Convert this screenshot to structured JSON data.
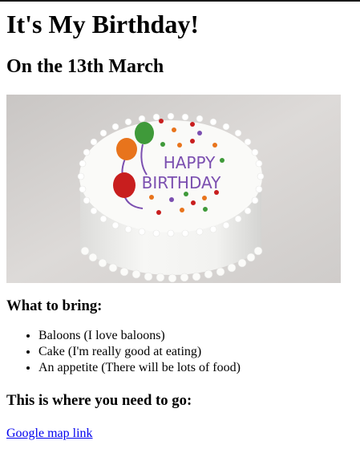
{
  "page": {
    "title": "It's My Birthday!",
    "subtitle": "On the 13th March"
  },
  "photo": {
    "alt_icon": "birthday-cake-image",
    "cake_text_line1": "HAPPY",
    "cake_text_line2": "BIRTHDAY",
    "colors": {
      "background": "#d9d6d4",
      "frosting": "#f5f5f3",
      "balloon_green": "#3f9a3a",
      "balloon_orange": "#e8741c",
      "balloon_red": "#c81e1e",
      "lettering": "#7b4fb0"
    }
  },
  "bring": {
    "heading": "What to bring:",
    "items": [
      "Baloons (I love baloons)",
      "Cake (I'm really good at eating)",
      "An appetite (There will be lots of food)"
    ]
  },
  "location": {
    "heading": "This is where you need to go:",
    "link_text": "Google map link"
  }
}
